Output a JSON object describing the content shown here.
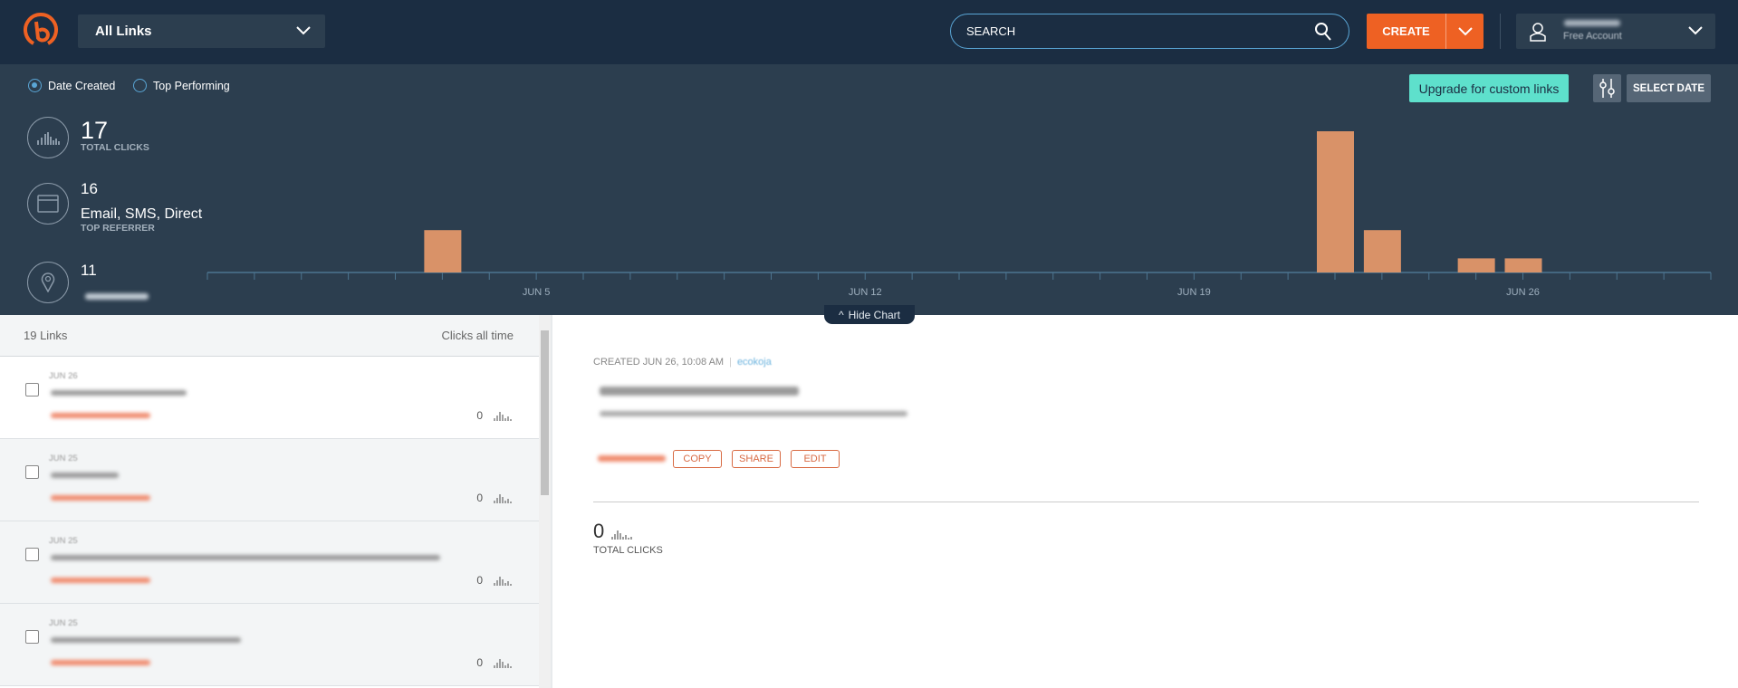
{
  "header": {
    "logo": "bitly-logo",
    "group_select": "All Links",
    "search_placeholder": "SEARCH",
    "create_label": "CREATE",
    "account_sub": "Free Account"
  },
  "controls": {
    "sort_options": [
      "Date Created",
      "Top Performing"
    ],
    "selected_sort": "Date Created",
    "upgrade_label": "Upgrade for custom links",
    "select_date_label": "SELECT DATE",
    "hide_chart_label": "Hide Chart"
  },
  "stats": {
    "total_clicks": "17",
    "total_clicks_label": "TOTAL CLICKS",
    "referrer_count": "16",
    "referrer_name": "Email, SMS, Direct",
    "referrer_label": "TOP REFERRER",
    "location_count": "11"
  },
  "chart_data": {
    "type": "bar",
    "x_range": [
      "May 29",
      "Jun 30"
    ],
    "tick_labels": [
      "JUN 5",
      "JUN 12",
      "JUN 19",
      "JUN 26"
    ],
    "bars": [
      {
        "date": "Jun 3",
        "value": 3
      },
      {
        "date": "Jun 22",
        "value": 10
      },
      {
        "date": "Jun 23",
        "value": 3
      },
      {
        "date": "Jun 25",
        "value": 1
      },
      {
        "date": "Jun 26",
        "value": 1
      }
    ],
    "color": "#d99268"
  },
  "list": {
    "count_label": "19 Links",
    "sort_label": "Clicks all time",
    "items": [
      {
        "date": "JUN 26",
        "clicks": "0"
      },
      {
        "date": "JUN 25",
        "clicks": "0"
      },
      {
        "date": "JUN 25",
        "clicks": "0"
      },
      {
        "date": "JUN 25",
        "clicks": "0"
      }
    ]
  },
  "detail": {
    "created": "CREATED JUN 26, 10:08 AM",
    "user": "ecokoja",
    "copy": "COPY",
    "share": "SHARE",
    "edit": "EDIT",
    "clicks": "0",
    "clicks_label": "TOTAL CLICKS"
  }
}
